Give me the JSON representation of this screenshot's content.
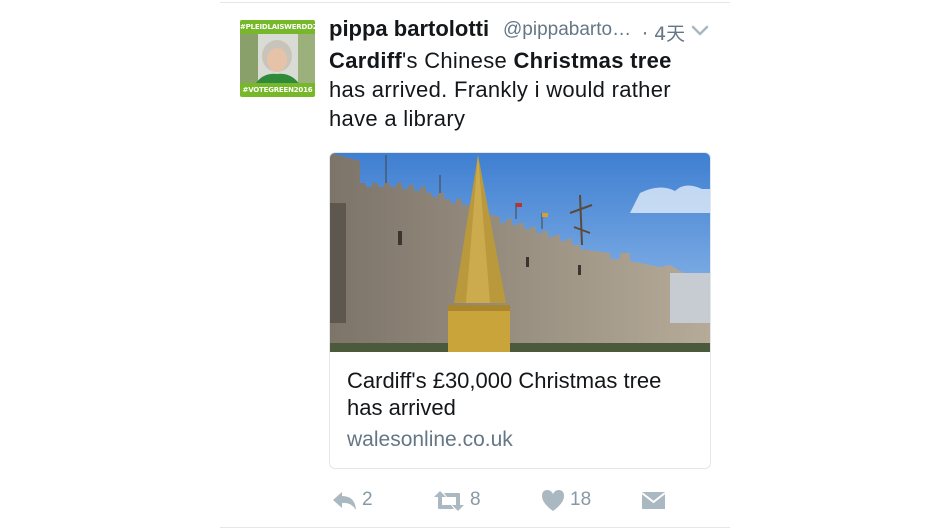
{
  "author": {
    "display_name": "pippa bartolotti",
    "handle": "@pippabarto…",
    "time_ago": "· 4天",
    "avatar_badge_top": "#PLEIDLAISWERDD2016",
    "avatar_badge_bottom": "#VOTEGREEN2016"
  },
  "tweet": {
    "parts": [
      {
        "text": "Cardiff",
        "bold": true
      },
      {
        "text": "'s Chinese ",
        "bold": false
      },
      {
        "text": "Christmas tree",
        "bold": true
      },
      {
        "text": " has arrived. Frankly i would rather have a library",
        "bold": false
      }
    ]
  },
  "card": {
    "title": "Cardiff's £30,000 Christmas tree has arrived",
    "domain": "walesonline.co.uk"
  },
  "actions": {
    "reply_count": "2",
    "retweet_count": "8",
    "like_count": "18"
  },
  "colors": {
    "text": "#14171a",
    "muted": "#657786",
    "action_gray": "#8899a6",
    "border": "#e1e8ed",
    "green_badge": "#77b82a"
  }
}
